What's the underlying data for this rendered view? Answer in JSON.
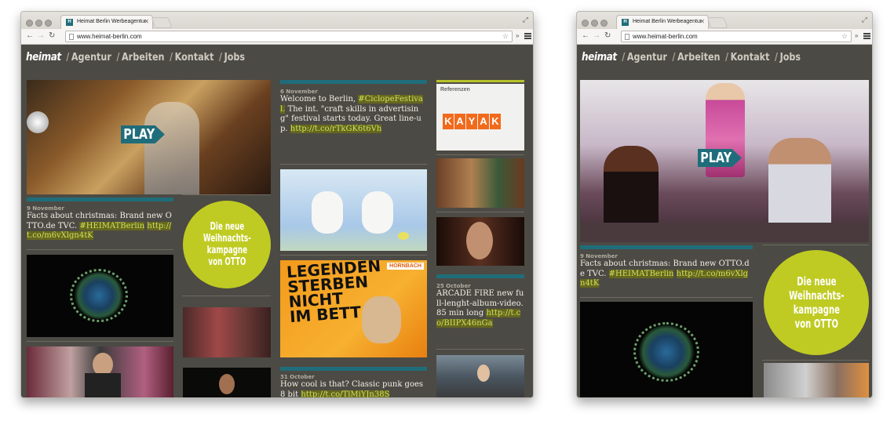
{
  "browser": {
    "tab_title": "Heimat Berlin Werbeagentur",
    "url": "www.heimat-berlin.com",
    "favicon_letter": "H"
  },
  "nav": {
    "logo": "heimat",
    "items": [
      "Agentur",
      "Arbeiten",
      "Kontakt",
      "Jobs"
    ],
    "separator": "/"
  },
  "play_label": "PLAY",
  "tweets": {
    "nov9": {
      "date": "9 November",
      "text": "Facts about christmas: Brand new OTTO.de TVC. ",
      "tag": "#HEIMATBerlin",
      "link": "http://t.co/m6vXlgn4tK"
    },
    "nov6": {
      "date": "6 November",
      "text_before": "Welcome to Berlin, ",
      "tag": "#CiclopeFestival.",
      "text_after": " The int. \"craft skills in advertising\" festival starts today. Great line-up. ",
      "link": "http://t.co/rTkGK6t6Vh"
    },
    "oct25": {
      "date": "25 October",
      "text": "ARCADE FIRE new full-lenght-album-video. 85 min long ",
      "link": "http://t.co/BIIPX46nGa"
    },
    "oct31": {
      "date": "31 October",
      "text": "How cool is that? Classic punk goes 8 bit ",
      "link": "http://t.co/TlMiYJn38S"
    }
  },
  "promo": {
    "line1": "Die neue",
    "line2": "Weihnachts-",
    "line3": "kampagne",
    "line4": "von OTTO"
  },
  "referenzen": {
    "label": "Referenzen",
    "brand_letters": [
      "K",
      "A",
      "Y",
      "A",
      "K"
    ]
  },
  "poster": {
    "brand": "HORNBACH",
    "line1": "LEGENDEN",
    "line2": "STERBEN",
    "line3": "NICHT",
    "line4": "IM BETT"
  },
  "colors": {
    "page_bg": "#4c4a44",
    "teal": "#1f6d7a",
    "lime": "#bfcb22",
    "link_hl": "#cfe05c"
  }
}
